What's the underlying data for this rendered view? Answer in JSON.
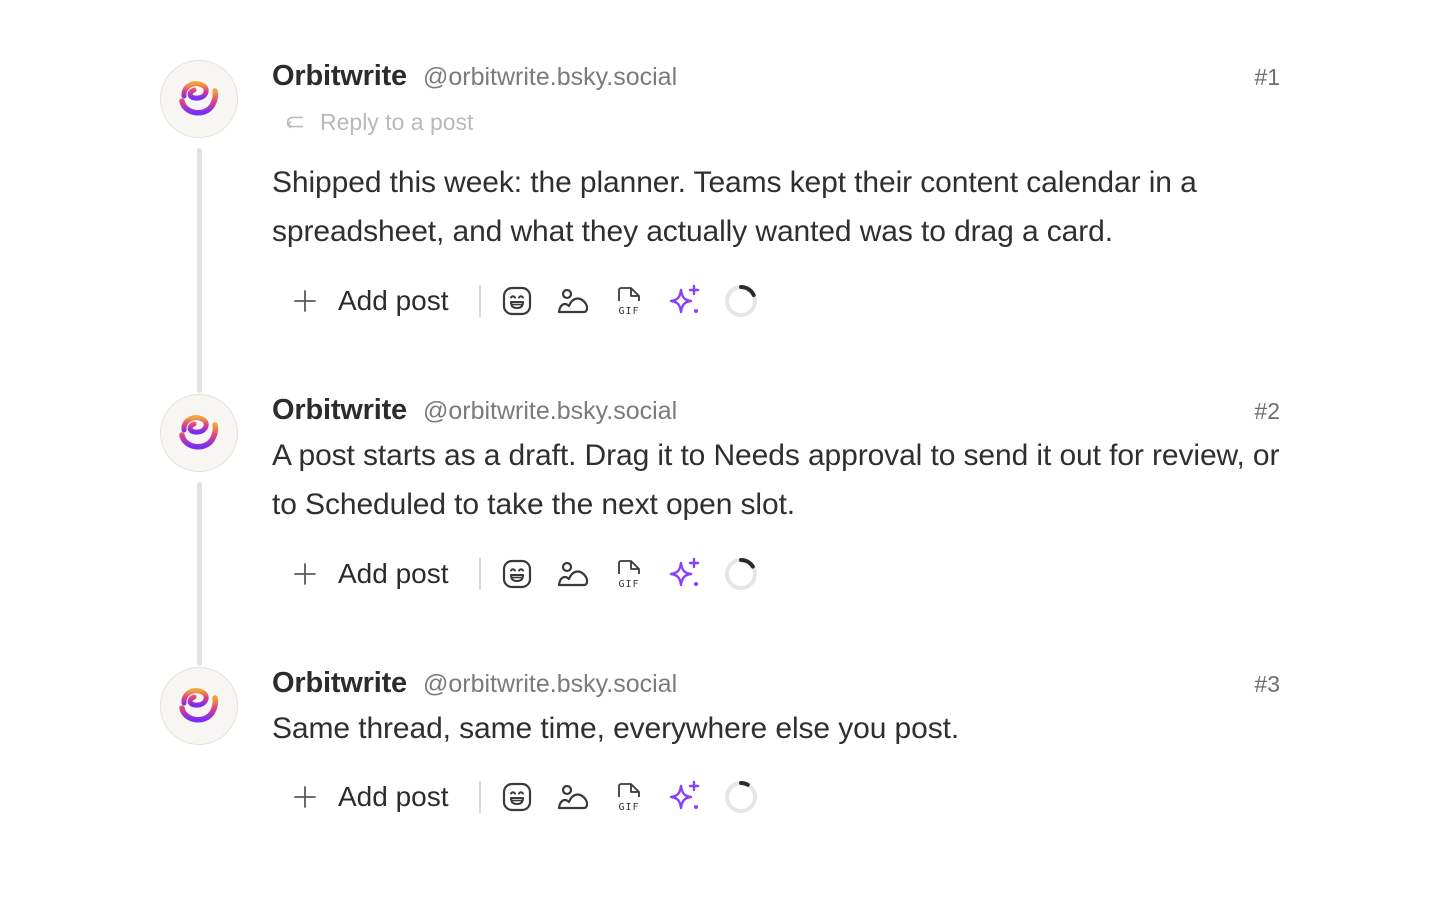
{
  "colors": {
    "accent": "#8a3ffc",
    "line": "#e2e2e2",
    "muted": "#7b7b7b",
    "text": "#2f2f2f"
  },
  "posts": [
    {
      "author": "Orbitwrite",
      "handle": "@orbitwrite.bsky.social",
      "number": "#1",
      "reply_label": "Reply to a post",
      "text": "Shipped this week: the planner. Teams kept their content calendar in a spreadsheet, and what they actually wanted was to drag a card.",
      "add_post_label": "Add post",
      "progress": 0.18
    },
    {
      "author": "Orbitwrite",
      "handle": "@orbitwrite.bsky.social",
      "number": "#2",
      "text": "A post starts as a draft. Drag it to Needs approval to send it out for review, or to Scheduled to take the next open slot.",
      "add_post_label": "Add post",
      "progress": 0.16
    },
    {
      "author": "Orbitwrite",
      "handle": "@orbitwrite.bsky.social",
      "number": "#3",
      "text": "Same thread, same time, everywhere else you post.",
      "add_post_label": "Add post",
      "progress": 0.08
    }
  ],
  "toolbar_icons": [
    "emoji-icon",
    "image-icon",
    "gif-icon",
    "ai-sparkle-icon",
    "character-count-icon"
  ]
}
